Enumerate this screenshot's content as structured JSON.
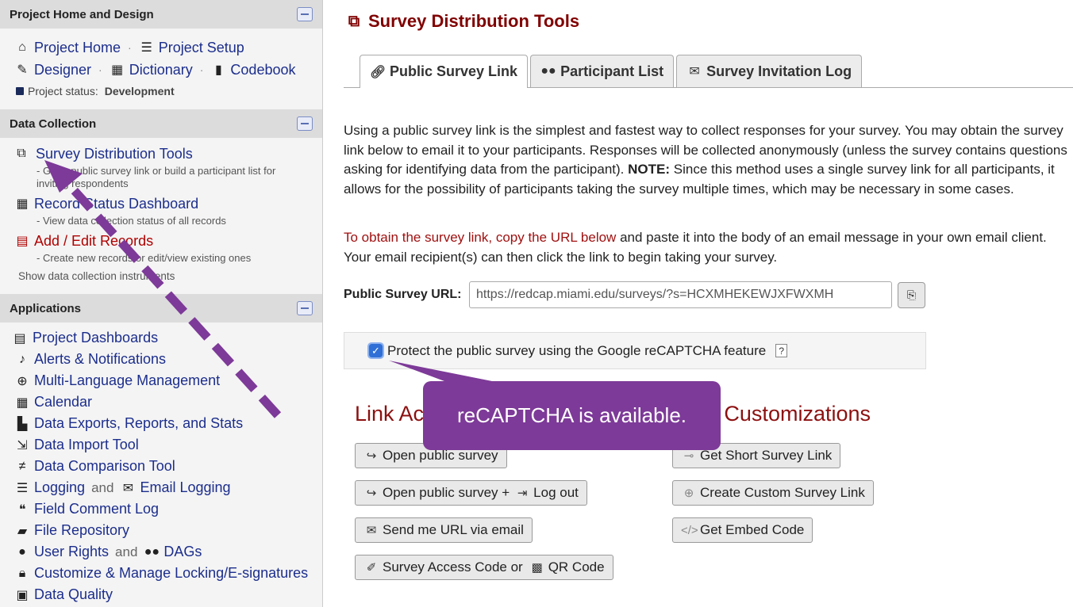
{
  "sidebar": {
    "sections": {
      "project_home": {
        "title": "Project Home and Design"
      },
      "data_collection": {
        "title": "Data Collection"
      },
      "applications": {
        "title": "Applications"
      }
    },
    "project_home": {
      "label": "Project Home"
    },
    "project_setup": {
      "label": "Project Setup"
    },
    "designer": {
      "label": "Designer"
    },
    "dictionary": {
      "label": "Dictionary"
    },
    "codebook": {
      "label": "Codebook"
    },
    "project_status": {
      "label": "Project status:",
      "value": "Development"
    },
    "survey_distribution": {
      "label": "Survey Distribution Tools",
      "desc": "- Get a public survey link or build a participant list for inviting respondents"
    },
    "record_status": {
      "label": "Record Status Dashboard",
      "desc": "- View data collection status of all records"
    },
    "add_edit": {
      "label": "Add / Edit Records",
      "desc": "- Create new records or edit/view existing ones"
    },
    "show_instruments": {
      "label": "Show data collection instruments"
    },
    "apps": {
      "project_dashboards": "Project Dashboards",
      "alerts": "Alerts & Notifications",
      "multilang": "Multi-Language Management",
      "calendar": "Calendar",
      "data_exports": "Data Exports, Reports, and Stats",
      "data_import": "Data Import Tool",
      "data_comparison": "Data Comparison Tool",
      "logging": "Logging",
      "and": "and",
      "email_logging": "Email Logging",
      "field_comment": "Field Comment Log",
      "file_repo": "File Repository",
      "user_rights": "User Rights",
      "dags": "DAGs",
      "customize_locking": "Customize & Manage Locking/E-signatures",
      "data_quality": "Data Quality"
    }
  },
  "main": {
    "title": "Survey Distribution Tools",
    "tabs": [
      "Public Survey Link",
      "Participant List",
      "Survey Invitation Log"
    ],
    "intro_p1": "Using a public survey link is the simplest and fastest way to collect responses for your survey. You may obtain the survey link below to email it to your participants. Responses will be collected anonymously (unless the survey contains questions asking for identifying data from the participant).",
    "intro_note_label": "NOTE:",
    "intro_p1_tail": "Since this method uses a single survey link for all participants, it allows for the possibility of participants taking the survey multiple times, which may be necessary in some cases.",
    "intro_p2_red": "To obtain the survey link, copy the URL below",
    "intro_p2_tail": "and paste it into the body of an email message in your own email client. Your email recipient(s) can then click the link to begin taking your survey.",
    "url_label": "Public Survey URL:",
    "url_value": "https://redcap.miami.edu/surveys/?s=HCXMHEKEWJXFWXMH",
    "captcha_label": "Protect the public survey using the Google reCAPTCHA feature",
    "captcha_help": "?",
    "section_left": "Link Ac",
    "section_right": "Customizations",
    "buttons": {
      "open_public": "Open public survey",
      "open_public_logout": "Open public survey +",
      "log_out": "Log out",
      "send_url": "Send me URL via email",
      "access_code": "Survey Access Code or",
      "qr_code": "QR Code",
      "short_link": "Get Short Survey Link",
      "custom_link": "Create Custom Survey Link",
      "embed_code": "Get Embed Code"
    }
  },
  "callout": {
    "text": "reCAPTCHA  is available."
  },
  "colors": {
    "accent_dark_red": "#800000",
    "link_blue": "#1c2e8c",
    "callout_purple": "#7d3a98"
  }
}
